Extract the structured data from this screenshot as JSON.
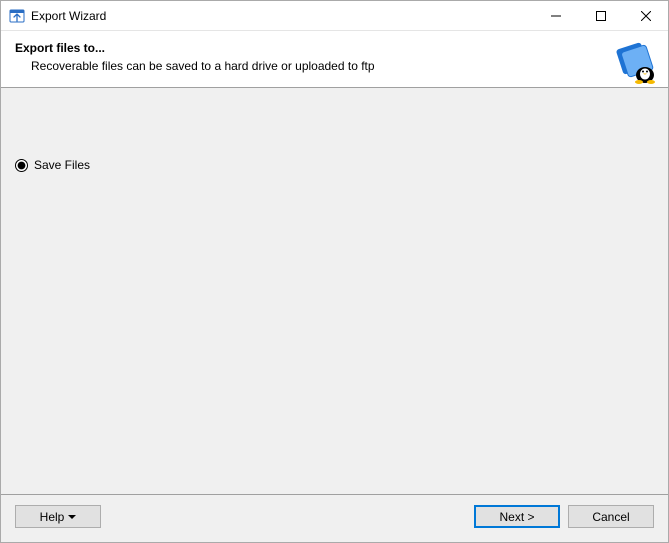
{
  "titlebar": {
    "title": "Export Wizard"
  },
  "header": {
    "title": "Export files to...",
    "subtitle": "Recoverable files can be saved to a hard drive or uploaded to ftp"
  },
  "body": {
    "options": {
      "save_files_label": "Save Files"
    }
  },
  "footer": {
    "help_label": "Help",
    "next_label": "Next >",
    "cancel_label": "Cancel"
  }
}
